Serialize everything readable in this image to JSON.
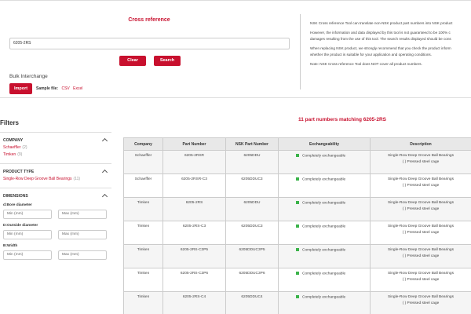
{
  "cross_reference": {
    "title": "Cross reference",
    "search_value": "6205-2RS",
    "clear_label": "Clear",
    "search_label": "Search",
    "bulk_label": "Bulk Interchange",
    "import_label": "Import",
    "sample_label": "Sample file:",
    "csv_label": "CSV",
    "excel_label": "Excel"
  },
  "info": {
    "p1": "NSK Cross reference Tool can translate non-NSK product part numbers into NSK product",
    "p2a": "However, the information and data displayed by this tool is not guaranteed to be 100% c",
    "p2b": "damages resulting from the use of this tool. The search results displayed should be cons",
    "p3a": "When replacing NSK product, we strongly recommend that you check the product inform",
    "p3b": "whether the product is suitable for your application and operating conditions.",
    "p4": "Note: NSK Cross reference Tool does NOT cover all product numbers."
  },
  "filters": {
    "title": "Filters",
    "company": {
      "heading": "COMPANY",
      "options": [
        {
          "label": "Schaeffler",
          "count": "(2)"
        },
        {
          "label": "Timken",
          "count": "(9)"
        }
      ]
    },
    "product_type": {
      "heading": "PRODUCT TYPE",
      "options": [
        {
          "label": "Single-Row Deep Groove Ball Bearings",
          "count": "(11)"
        }
      ]
    },
    "dimensions": {
      "heading": "DIMENSIONS",
      "min_placeholder": "Min (mm)",
      "max_placeholder": "Max (mm)",
      "groups": [
        {
          "label": "d:Bore diameter"
        },
        {
          "label": "D:Outside diameter"
        },
        {
          "label": "B:Width"
        }
      ]
    }
  },
  "results": {
    "title": "11 part numbers matching 6205-2RS",
    "columns": [
      "Company",
      "Part Number",
      "NSK Part Number",
      "Exchangeability",
      "Description"
    ],
    "rows": [
      {
        "company": "Schaeffler",
        "part": "6205-2RSR",
        "nsk": "6205DDU",
        "exch": "Completely exchangeable",
        "desc1": "Single-Row Deep Groove Ball Bearings",
        "desc2": "( ) Pressed steel cage"
      },
      {
        "company": "Schaeffler",
        "part": "6205-2RSR-C3",
        "nsk": "6205DDUC3",
        "exch": "Completely exchangeable",
        "desc1": "Single-Row Deep Groove Ball Bearings",
        "desc2": "( ) Pressed steel cage"
      },
      {
        "company": "Timken",
        "part": "6205-2RS",
        "nsk": "6205DDU",
        "exch": "Completely exchangeable",
        "desc1": "Single-Row Deep Groove Ball Bearings",
        "desc2": "( ) Pressed steel cage"
      },
      {
        "company": "Timken",
        "part": "6205-2RS-C3",
        "nsk": "6205DDUC3",
        "exch": "Completely exchangeable",
        "desc1": "Single-Row Deep Groove Ball Bearings",
        "desc2": "( ) Pressed steel cage"
      },
      {
        "company": "Timken",
        "part": "6205-2RS-C3P5",
        "nsk": "6205DDUC3P5",
        "exch": "Completely exchangeable",
        "desc1": "Single-Row Deep Groove Ball Bearings",
        "desc2": "( ) Pressed steel cage"
      },
      {
        "company": "Timken",
        "part": "6205-2RS-C3P6",
        "nsk": "6205DDUC3P6",
        "exch": "Completely exchangeable",
        "desc1": "Single-Row Deep Groove Ball Bearings",
        "desc2": "( ) Pressed steel cage"
      },
      {
        "company": "Timken",
        "part": "6205-2RS-C4",
        "nsk": "6205DDUC4",
        "exch": "Completely exchangeable",
        "desc1": "Single-Row Deep Groove Ball Bearings",
        "desc2": "( ) Pressed steel cage"
      }
    ]
  },
  "colors": {
    "accent": "#c8102e",
    "exchange_indicator": "#3bb34a"
  }
}
